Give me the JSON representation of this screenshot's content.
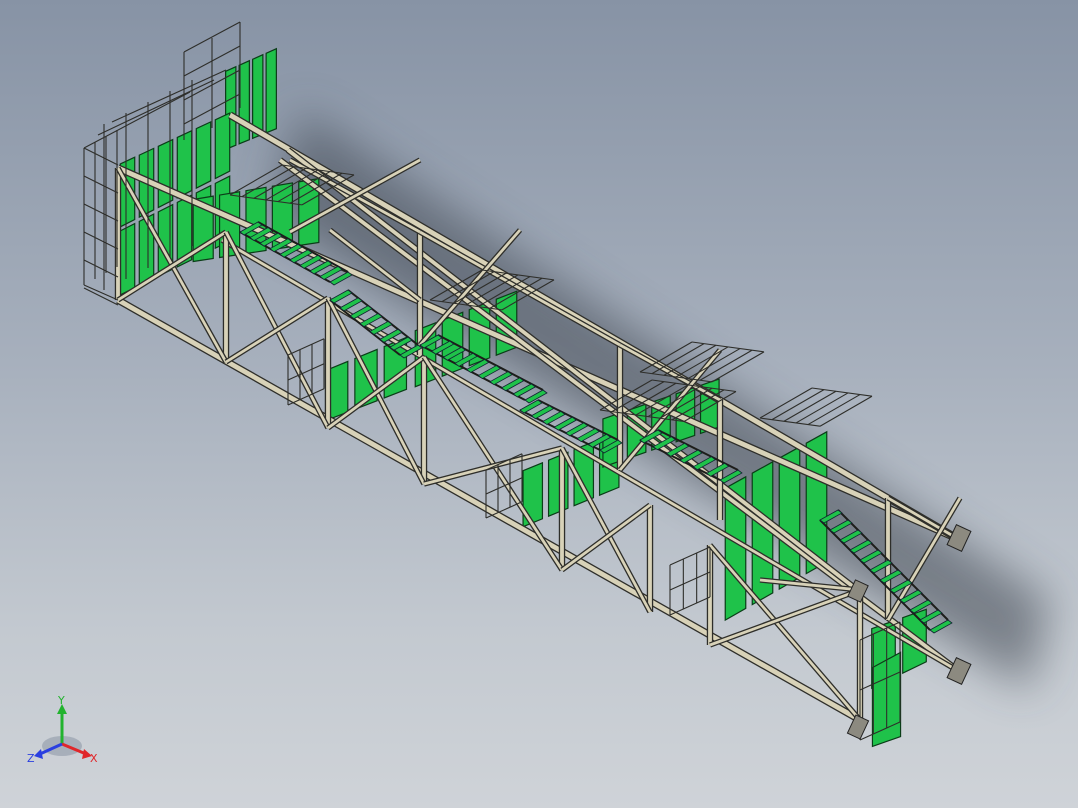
{
  "viewport": {
    "background_top": "#8793a5",
    "background_bottom": "#cfd3d8"
  },
  "model": {
    "description_icon": "steel-truss-gallery-model",
    "frame_color": "#d8d2b8",
    "frame_edge_color": "#2e2e2a",
    "panel_color": "#1fc24a",
    "panel_edge_color": "#0b3d18",
    "shadow_color": "#3c4450"
  },
  "triad": {
    "x_label": "X",
    "y_label": "Y",
    "z_label": "Z",
    "x_color": "#e0262a",
    "y_color": "#22b32e",
    "z_color": "#2a3fe0"
  }
}
